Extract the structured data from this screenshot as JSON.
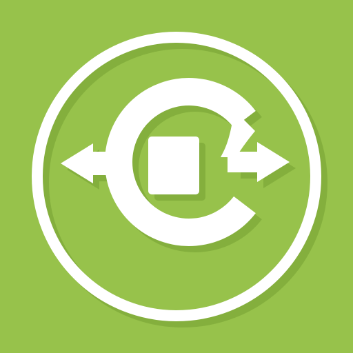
{
  "icon": {
    "name": "sync-transfer-icon",
    "background_color": "#97c24b",
    "foreground_color": "#ffffff",
    "shadow_color": "#6f9a2e"
  }
}
